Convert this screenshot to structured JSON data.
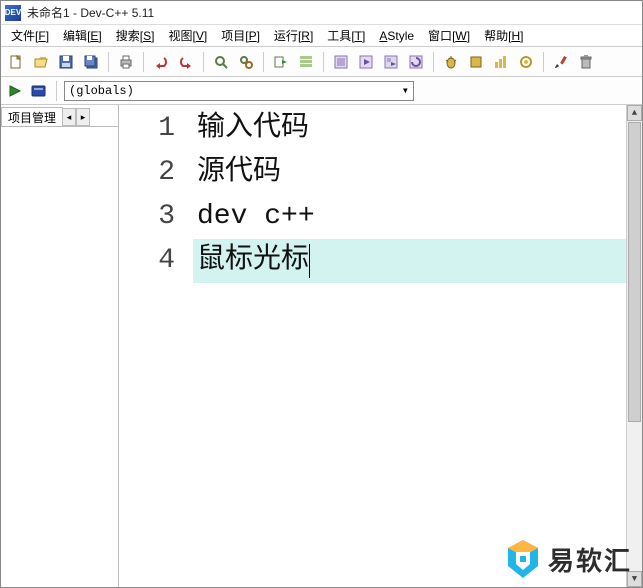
{
  "title": "未命名1 - Dev-C++ 5.11",
  "app_icon_text": "DEV",
  "menu": {
    "file": {
      "label": "文件",
      "hotkey": "F"
    },
    "edit": {
      "label": "编辑",
      "hotkey": "E"
    },
    "search": {
      "label": "搜索",
      "hotkey": "S"
    },
    "view": {
      "label": "视图",
      "hotkey": "V"
    },
    "project": {
      "label": "项目",
      "hotkey": "P"
    },
    "run": {
      "label": "运行",
      "hotkey": "R"
    },
    "tools": {
      "label": "工具",
      "hotkey": "T"
    },
    "astyle": {
      "label": "AStyle",
      "hotkey": ""
    },
    "window": {
      "label": "窗口",
      "hotkey": "W"
    },
    "help": {
      "label": "帮助",
      "hotkey": "H"
    }
  },
  "toolbar_icons": [
    "new-file-icon",
    "open-icon",
    "save-icon",
    "save-all-icon",
    "sep",
    "print-icon",
    "sep",
    "undo-icon",
    "redo-icon",
    "sep",
    "find-icon",
    "replace-icon",
    "sep",
    "goto-icon",
    "bookmark-icon",
    "sep",
    "compile-icon",
    "run-icon",
    "compile-run-icon",
    "rebuild-icon",
    "sep",
    "debug-icon",
    "stop-debug-icon",
    "profile-icon",
    "attach-icon",
    "sep",
    "brush-icon",
    "trash-icon"
  ],
  "secondrow": {
    "icons": [
      "go-icon",
      "book-icon"
    ],
    "scope_label": "(globals)",
    "dropdown_arrow": "▾"
  },
  "sidebar": {
    "tab_label": "项目管理",
    "nav_left": "◂",
    "nav_right": "▸"
  },
  "editor": {
    "gutter": [
      "1",
      "2",
      "3",
      "4"
    ],
    "lines": [
      {
        "text": "输入代码",
        "highlight": false,
        "cursor": false
      },
      {
        "text": "源代码",
        "highlight": false,
        "cursor": false
      },
      {
        "text": "dev c++",
        "highlight": false,
        "cursor": false
      },
      {
        "text": "鼠标光标",
        "highlight": true,
        "cursor": true
      }
    ]
  },
  "scrollbar": {
    "up": "▲",
    "down": "▼"
  },
  "watermark": {
    "text": "易软汇"
  }
}
